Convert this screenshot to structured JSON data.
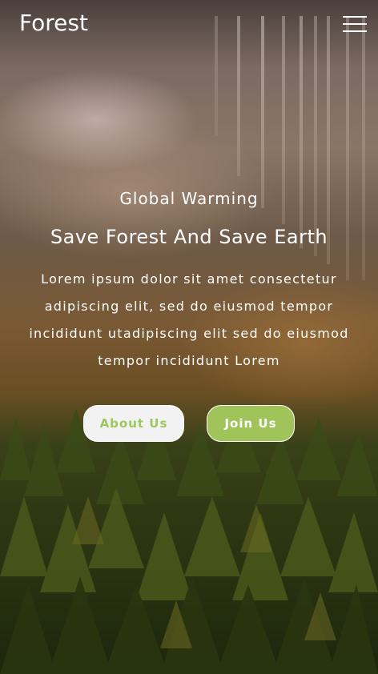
{
  "header": {
    "logo": "Forest",
    "menu_icon": "hamburger-menu-icon"
  },
  "hero": {
    "eyebrow": "Global Warming",
    "title": "Save Forest And Save Earth",
    "description": "Lorem ipsum dolor sit amet consectetur adipiscing elit, sed do eiusmod tempor incididunt utadipiscing elit sed do eiusmod tempor incididunt Lorem",
    "background_image": "misty-forest-photo"
  },
  "buttons": {
    "about_label": "About Us",
    "join_label": "Join Us"
  },
  "colors": {
    "accent_green": "#a0c45a",
    "about_text": "#9cc85e",
    "about_bg": "#f2f2f2"
  }
}
